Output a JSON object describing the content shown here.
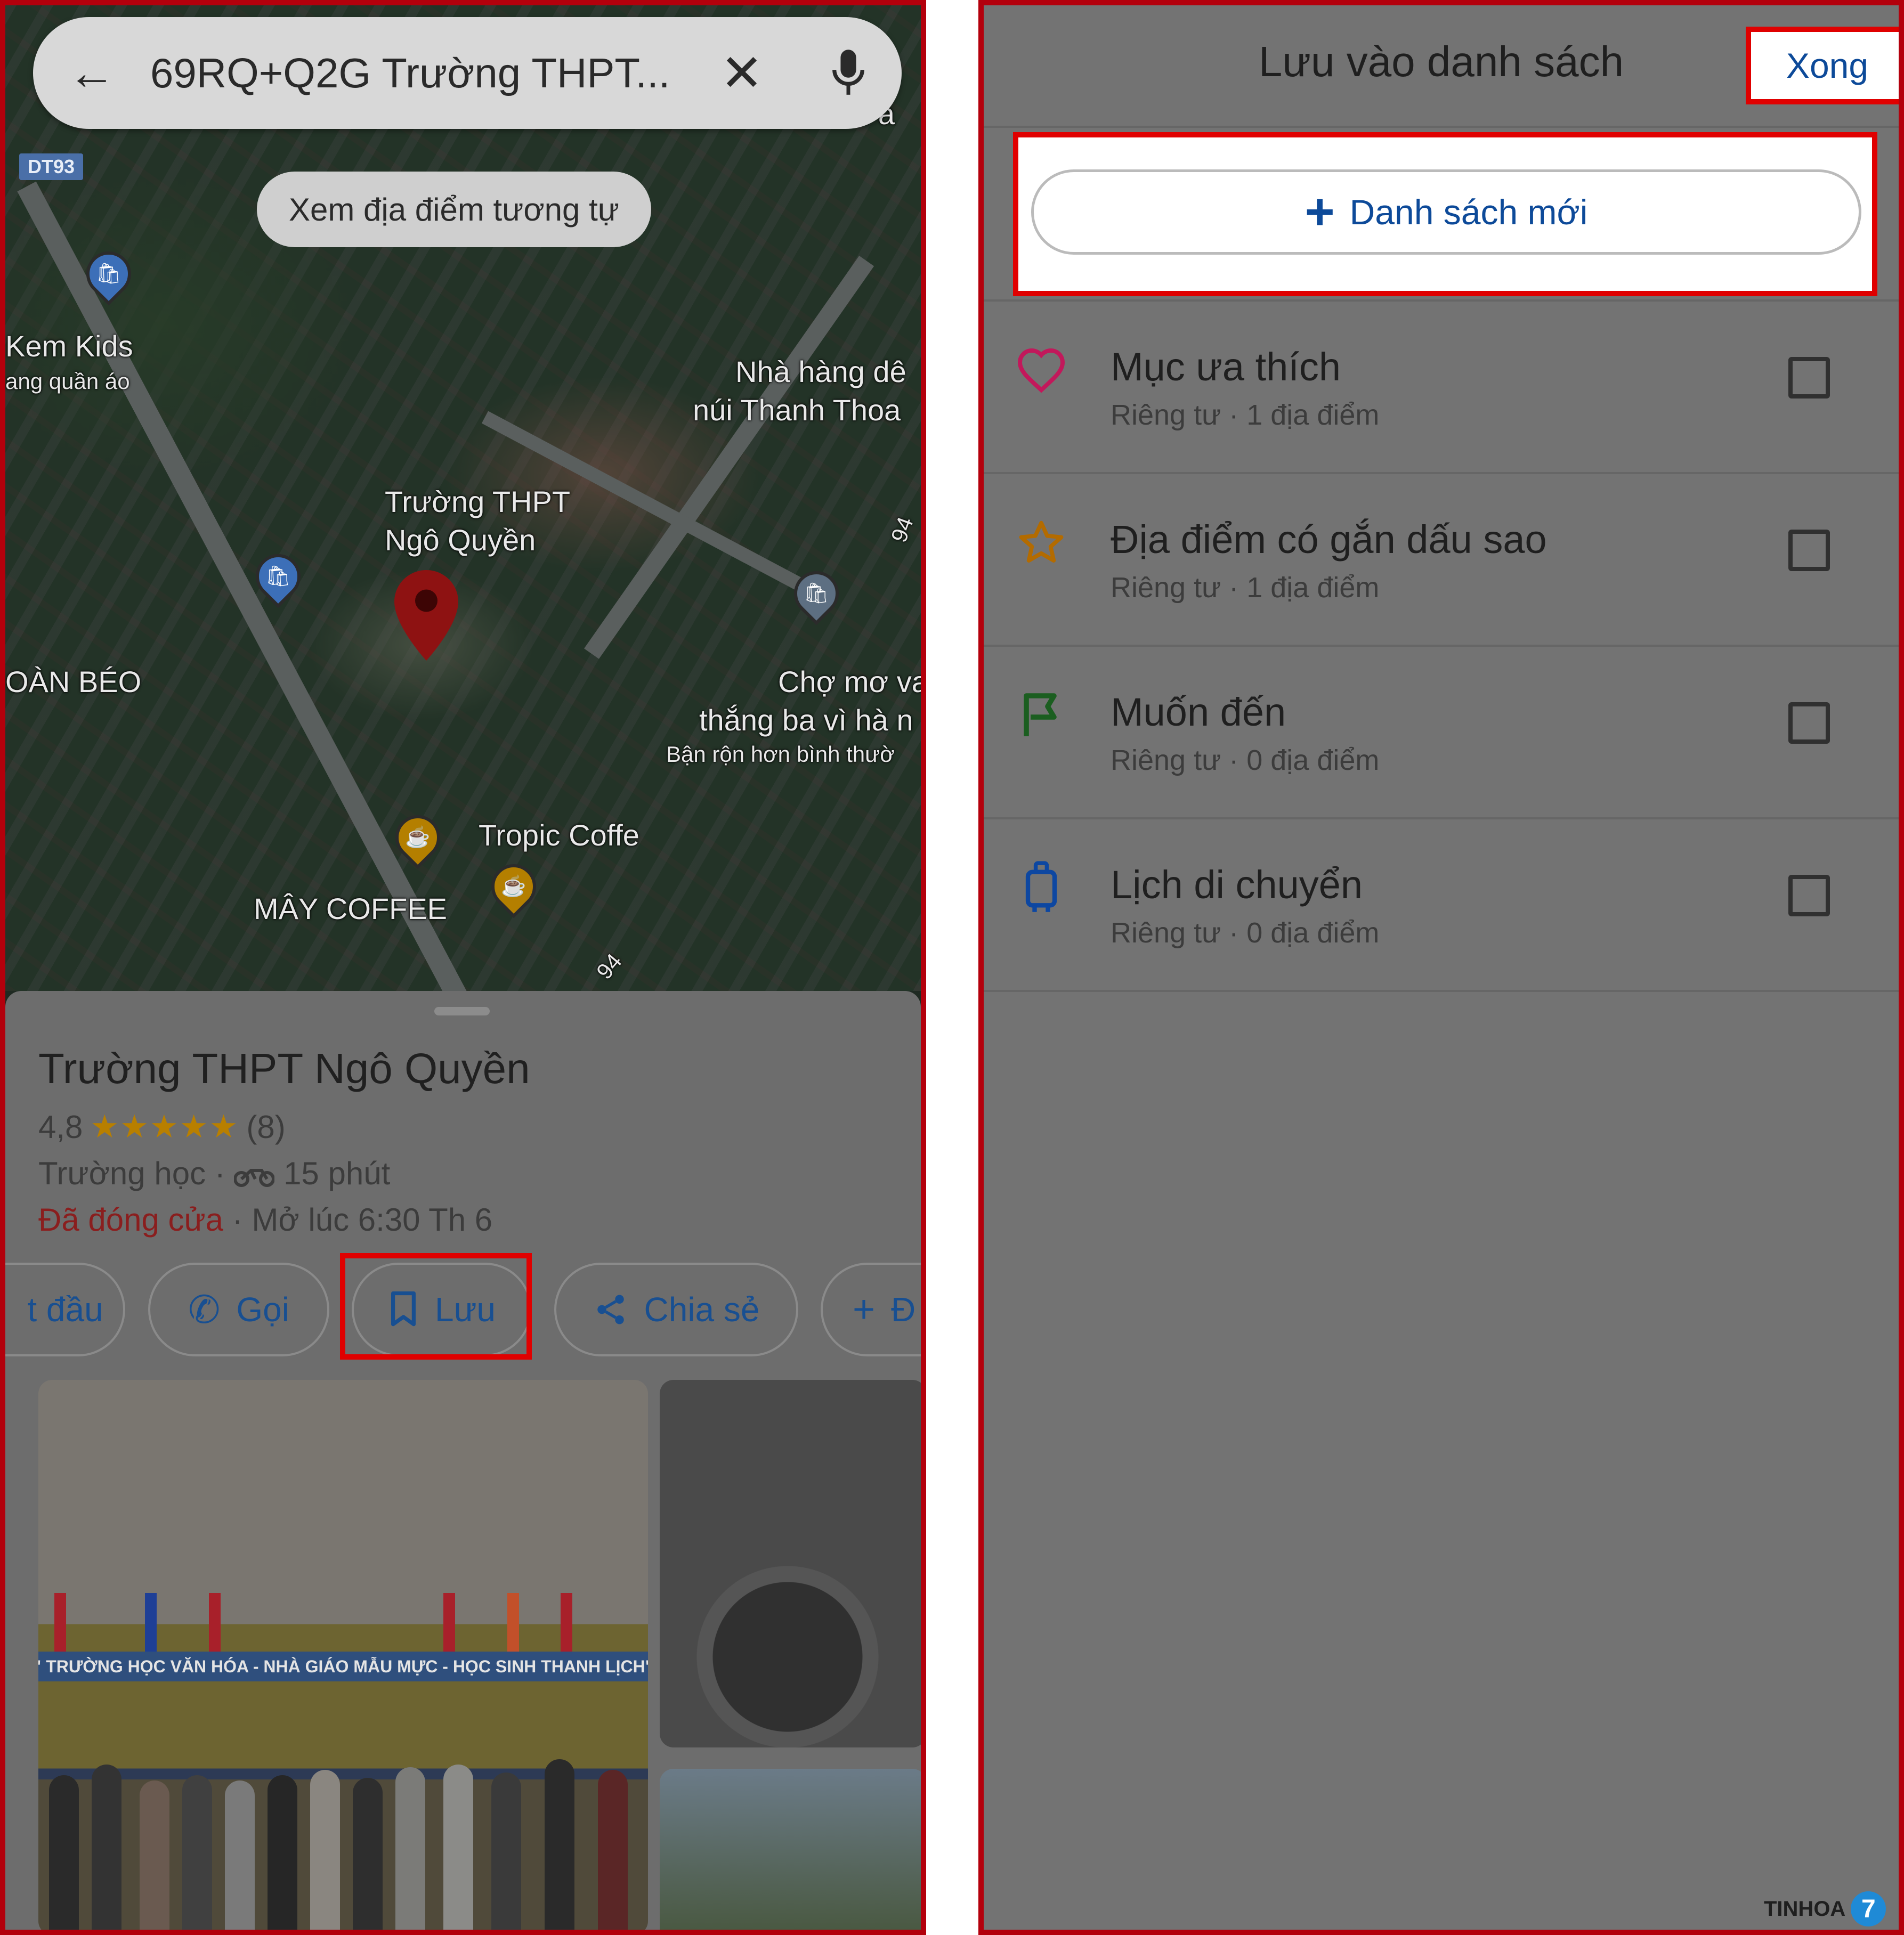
{
  "search": {
    "query": "69RQ+Q2G Trường THPT...",
    "similar_chip": "Xem địa điểm tương tự"
  },
  "map": {
    "road_badge": "DT93",
    "labels": {
      "kem_kids": "Kem Kids",
      "kem_kids_sub": "ang quần áo",
      "nha_hang_1": "Nhà hàng dê",
      "nha_hang_2": "núi Thanh Thoa",
      "school_1": "Trường THPT",
      "school_2": "Ngô Quyền",
      "doan_beo": "OÀN BÉO",
      "cho_1": "Chợ mơ va",
      "cho_2": "thắng ba vì hà n",
      "cho_3": "Bận rộn hơn bình thườ",
      "tropic": "Tropic Coffe",
      "may_coffee": "MÂY COFFEE",
      "road_94a": "94",
      "road_94b": "94",
      "top_right": "an ả"
    }
  },
  "place": {
    "title": "Trường THPT Ngô Quyền",
    "rating": "4,8",
    "stars": "★★★★★",
    "reviews": "(8)",
    "category": "Trường học",
    "separator": "·",
    "travel_time": "15 phút",
    "status_closed": "Đã đóng cửa",
    "opens": "· Mở lúc 6:30 Th 6"
  },
  "actions": {
    "start": "t đầu",
    "call": "Gọi",
    "save": "Lưu",
    "share": "Chia sẻ",
    "more": "Đ"
  },
  "photo": {
    "banner": "\" TRƯỜNG HỌC VĂN HÓA - NHÀ GIÁO MẪU MỰC - HỌC SINH THANH LỊCH\""
  },
  "save_dialog": {
    "title": "Lưu vào danh sách",
    "done": "Xong",
    "new_list": "Danh sách mới",
    "lists": [
      {
        "name": "Mục ưa thích",
        "meta": "Riêng tư · 1 địa điểm",
        "icon": "heart-icon",
        "icon_color": "#c2185b",
        "checked": false
      },
      {
        "name": "Địa điểm có gắn dấu sao",
        "meta": "Riêng tư · 1 địa điểm",
        "icon": "star-icon",
        "icon_color": "#b36b00",
        "checked": false
      },
      {
        "name": "Muốn đến",
        "meta": "Riêng tư · 0 địa điểm",
        "icon": "flag-icon",
        "icon_color": "#1b5e20",
        "checked": false
      },
      {
        "name": "Lịch di chuyển",
        "meta": "Riêng tư · 0 địa điểm",
        "icon": "suitcase-icon",
        "icon_color": "#0d47a1",
        "checked": false
      }
    ]
  },
  "watermark": {
    "brand": "TINHOA",
    "badge": "7"
  },
  "colors": {
    "highlight": "#e00000",
    "accent_blue": "#0d4a99",
    "closed_red": "#8a1e1e",
    "frame_red": "#b3000c"
  }
}
